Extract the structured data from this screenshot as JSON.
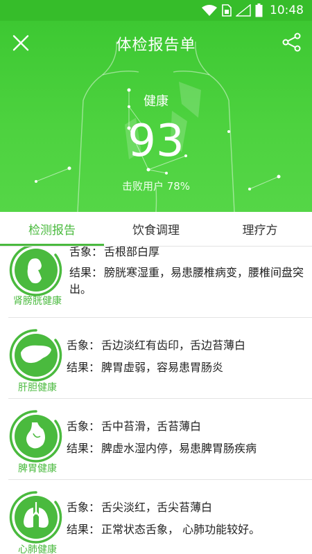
{
  "status_bar": {
    "time": "10:48"
  },
  "header": {
    "title": "体检报告单",
    "score_label": "健康",
    "score": "93",
    "beat_text": "击败用户 78%"
  },
  "tabs": [
    {
      "label": "检测报告",
      "active": true
    },
    {
      "label": "饮食调理",
      "active": false
    },
    {
      "label": "理疗方",
      "active": false
    }
  ],
  "items": [
    {
      "label": "肾膀胱健康",
      "icon": "kidney-icon",
      "tongue_key": "舌象：",
      "tongue": "舌根部白厚",
      "result_key": "结果：",
      "result": "膀胱寒湿重，易患腰椎病变，腰椎间盘突出。"
    },
    {
      "label": "肝胆健康",
      "icon": "liver-icon",
      "tongue_key": "舌象：",
      "tongue": "舌边淡红有齿印，舌边苔薄白",
      "result_key": "结果：",
      "result": "脾胃虚弱，容易患胃肠炎"
    },
    {
      "label": "脾胃健康",
      "icon": "stomach-icon",
      "tongue_key": "舌象：",
      "tongue": "舌中苔滑，舌苔薄白",
      "result_key": "结果：",
      "result": "脾虚水湿内停，易患脾胃肠疾病"
    },
    {
      "label": "心肺健康",
      "icon": "lungs-icon",
      "tongue_key": "舌象：",
      "tongue": "舌尖淡红，舌尖苔薄白",
      "result_key": "结果：",
      "result": "正常状态舌象， 心肺功能较好。"
    }
  ],
  "colors": {
    "accent": "#4aba3e",
    "header": "#45cc38"
  }
}
